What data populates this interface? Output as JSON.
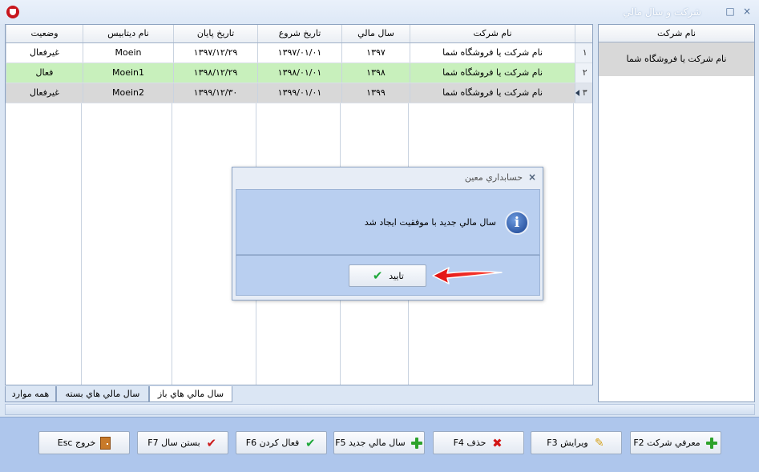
{
  "window": {
    "title": "شرکت و سال مالي"
  },
  "grid": {
    "columns": [
      "",
      "نام شرکت",
      "سال مالي",
      "تاريخ شروع",
      "تاريخ پايان",
      "نام ديتابيس",
      "وضعيت"
    ],
    "rows": [
      {
        "index": "۱",
        "company": "نام شرکت یا فروشگاه شما",
        "year": "۱۳۹۷",
        "start": "۱۳۹۷/۰۱/۰۱",
        "end": "۱۳۹۷/۱۲/۲۹",
        "db": "Moein",
        "status": "غيرفعال"
      },
      {
        "index": "۲",
        "company": "نام شرکت یا فروشگاه شما",
        "year": "۱۳۹۸",
        "start": "۱۳۹۸/۰۱/۰۱",
        "end": "۱۳۹۸/۱۲/۲۹",
        "db": "Moein1",
        "status": "فعال"
      },
      {
        "index": "۳",
        "company": "نام شرکت یا فروشگاه شما",
        "year": "۱۳۹۹",
        "start": "۱۳۹۹/۰۱/۰۱",
        "end": "۱۳۹۹/۱۲/۳۰",
        "db": "Moein2",
        "status": "غيرفعال"
      }
    ]
  },
  "tabs": [
    "سال مالي هاي باز",
    "سال مالي هاي بسته",
    "همه موارد"
  ],
  "side": {
    "header": "نام شرکت",
    "row": "نام شرکت یا فروشگاه شما"
  },
  "toolbar": {
    "buttons": [
      {
        "label": "معرفي شرکت F2",
        "icon": "plus-icon"
      },
      {
        "label": "ويرايش F3",
        "icon": "pencil-icon"
      },
      {
        "label": "حذف F4",
        "icon": "x-icon"
      },
      {
        "label": "سال مالي جديد F5",
        "icon": "plus-icon"
      },
      {
        "label": "فعال کردن F6",
        "icon": "check-icon"
      },
      {
        "label": "بستن سال F7",
        "icon": "check-red-icon"
      },
      {
        "label": "خروج Esc",
        "icon": "door-icon"
      }
    ]
  },
  "dialog": {
    "title": "حسابداري معين",
    "message": "سال مالي جديد با موفقيت ايجاد شد",
    "ok_label": "تاييد",
    "icon": "info-icon"
  },
  "icons": {
    "close": "×",
    "minimize": "‒",
    "maximize": "□",
    "info": "i",
    "check": "✔",
    "x": "✖",
    "pencil": "✎"
  },
  "colors": {
    "active_row": "#c8f0bc",
    "current_row": "#d8d8d8",
    "toolbar": "#aec6ec",
    "arrow": "#e01010"
  }
}
